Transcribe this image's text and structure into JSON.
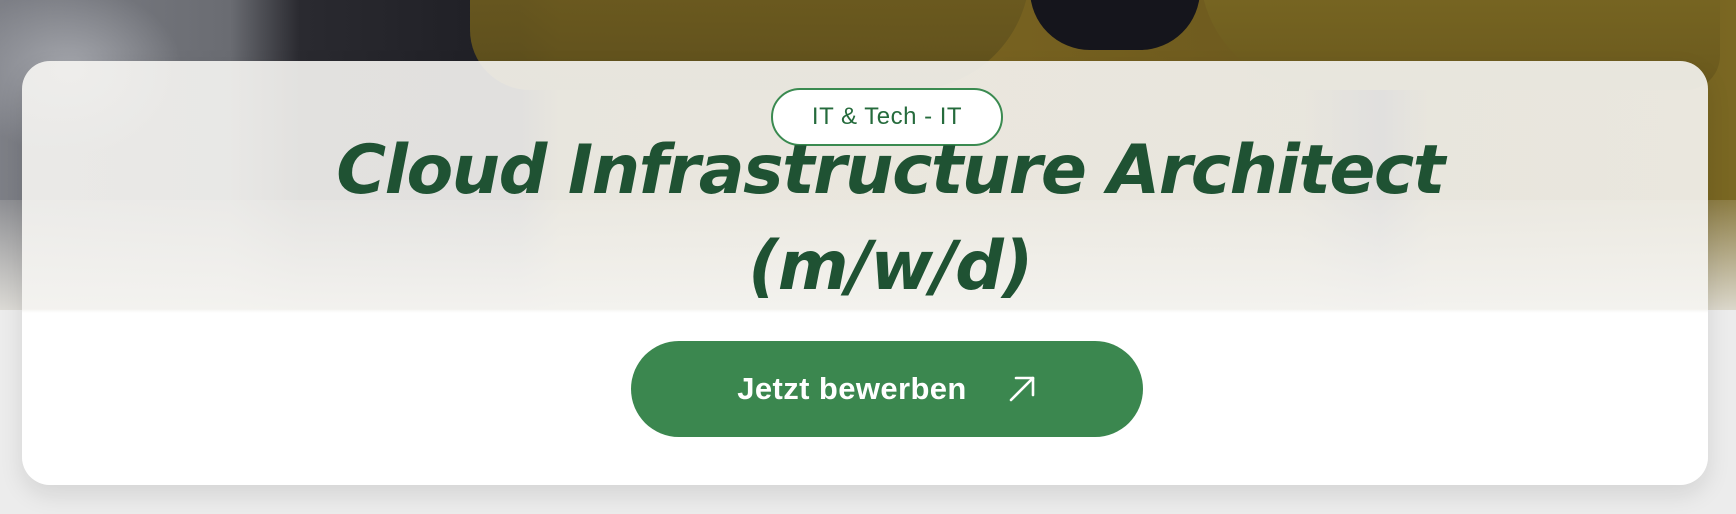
{
  "badge": {
    "label": "IT & Tech - IT"
  },
  "job": {
    "title_line1": "Cloud Infrastructure Architect",
    "title_line2": "(m/w/d)"
  },
  "apply_button": {
    "label": "Jetzt bewerben",
    "icon": "arrow-up-right-icon"
  },
  "colors": {
    "brand_green": "#3b874f",
    "title_green": "#1f5233",
    "badge_border": "#3a8a50"
  }
}
